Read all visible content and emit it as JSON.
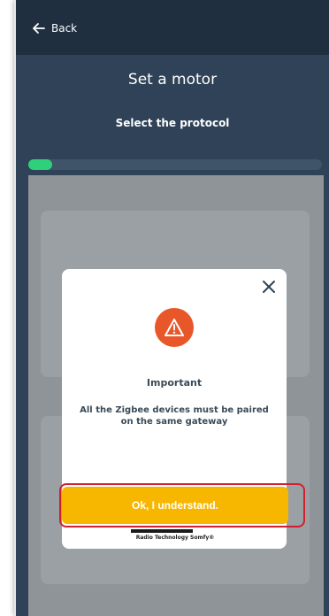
{
  "header": {
    "back_label": "Back"
  },
  "screen": {
    "title": "Set a motor",
    "subtitle": "Select the protocol"
  },
  "progress": {
    "value_percent": 2
  },
  "modal": {
    "heading": "Important",
    "message": "All the Zigbee devices must be paired on the same gateway",
    "primary_button": "Ok, I understand.",
    "brand_text": "Radio Technology Somfy®",
    "icons": {
      "close": "close-icon",
      "warning": "warning-icon"
    }
  },
  "colors": {
    "topbar": "#1f2f40",
    "background": "#2f4257",
    "accent_button": "#f7b700",
    "warning": "#e8572a",
    "progress": "#2fd07a",
    "highlight": "#d01f2e"
  }
}
